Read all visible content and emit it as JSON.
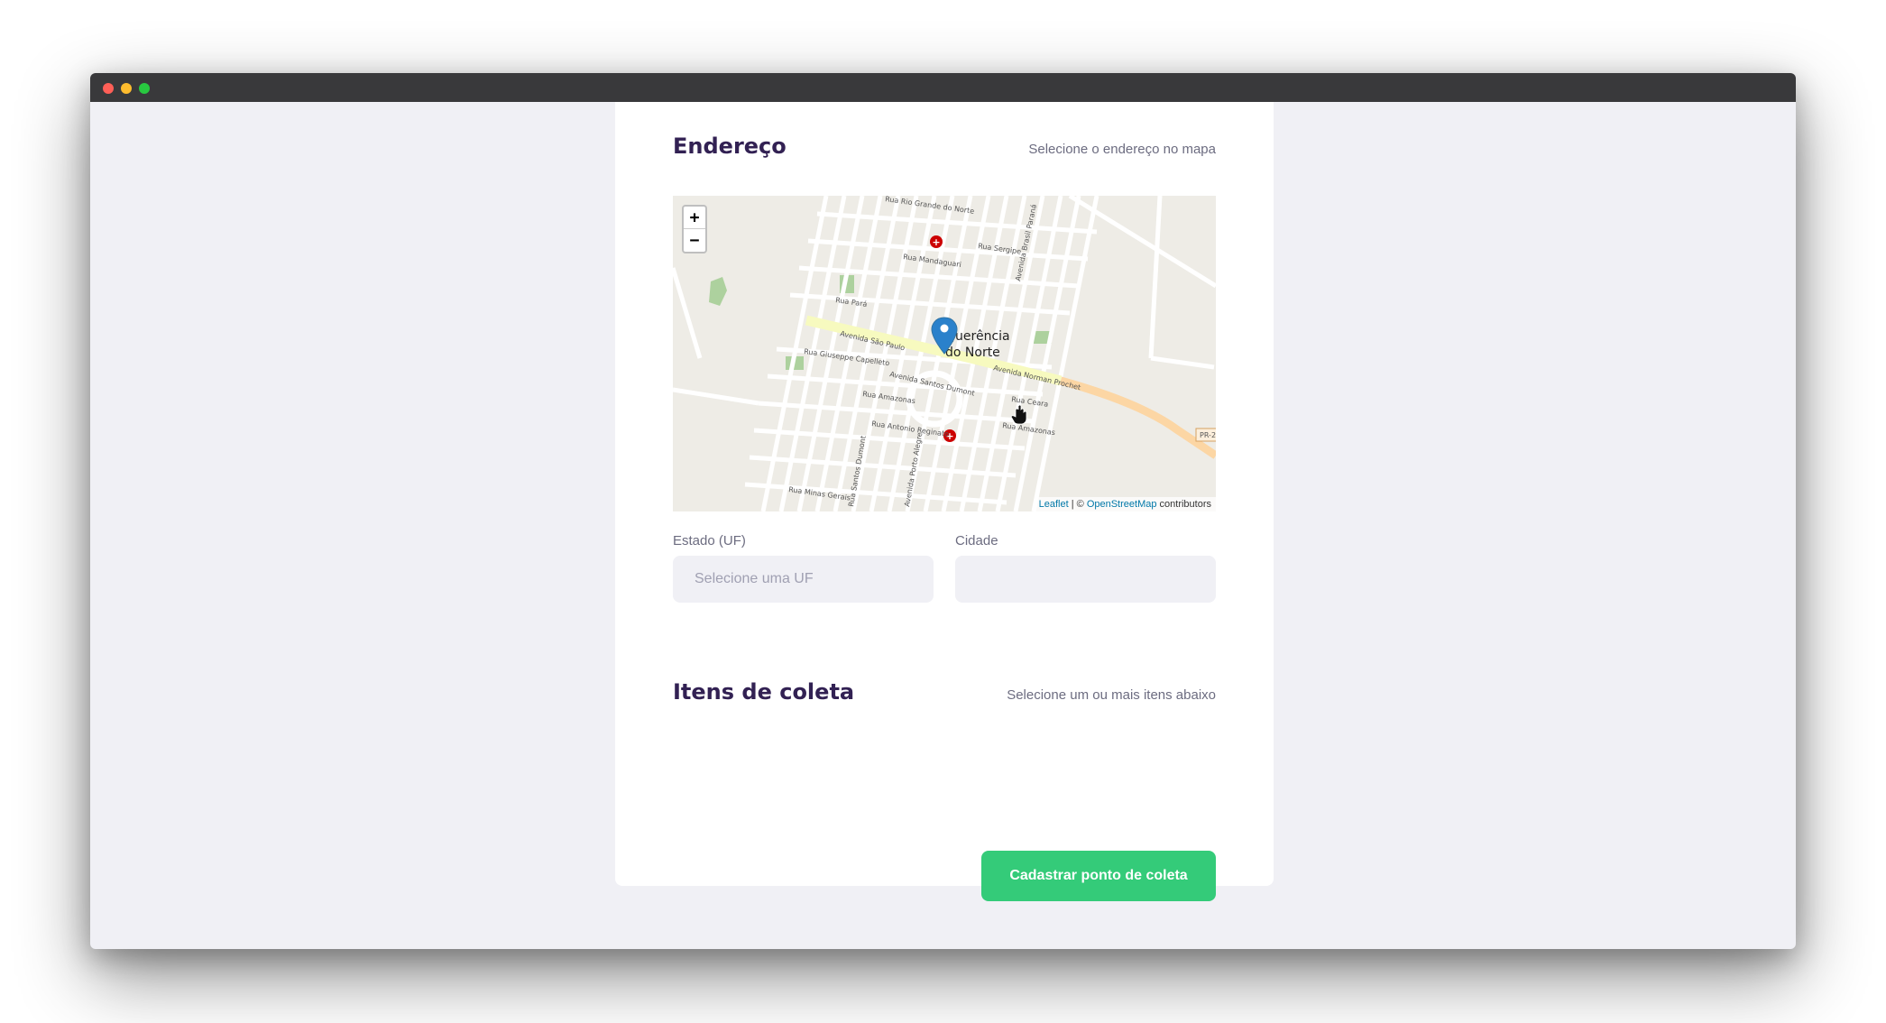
{
  "address_section": {
    "title": "Endereço",
    "subtitle": "Selecione o endereço no mapa"
  },
  "map": {
    "zoom_in": "+",
    "zoom_out": "−",
    "city_label_line1": "Querência",
    "city_label_line2": "do Norte",
    "streets": {
      "s1": "Avenida São Paulo",
      "s2": "Avenida Norman Prochet",
      "s3": "Avenida Santos Dumont",
      "s4": "Rua Giuseppe Capelleto",
      "s5": "Rua Amazonas",
      "s6": "Rua Antonio Reginato",
      "s7": "Rua Ceara",
      "s8": "Rua Amazonas",
      "s9": "Rua Minas Gerais",
      "s10": "Rua Rio Grande do Norte",
      "s11": "Rua Mandaguari",
      "s12": "Rua Sergipe",
      "s13": "Rua Pará",
      "s14": "Avenida Brasil Paraná",
      "s15": "Avenida Porto Alegre",
      "s16": "Rua Santos Dumont",
      "s17": "PR-2"
    },
    "attribution_leaflet": "Leaflet",
    "attribution_sep": " | © ",
    "attribution_osm": "OpenStreetMap",
    "attribution_tail": " contributors",
    "marker_color": "#2a81cb"
  },
  "fields": {
    "uf_label": "Estado (UF)",
    "uf_placeholder": "Selecione uma UF",
    "city_label": "Cidade",
    "city_value": ""
  },
  "items_section": {
    "title": "Itens de coleta",
    "subtitle": "Selecione um ou mais itens abaixo"
  },
  "submit_label": "Cadastrar ponto de coleta",
  "colors": {
    "primary": "#34cb79",
    "title": "#322153",
    "text": "#6c6c80",
    "background": "#f0f0f5"
  }
}
